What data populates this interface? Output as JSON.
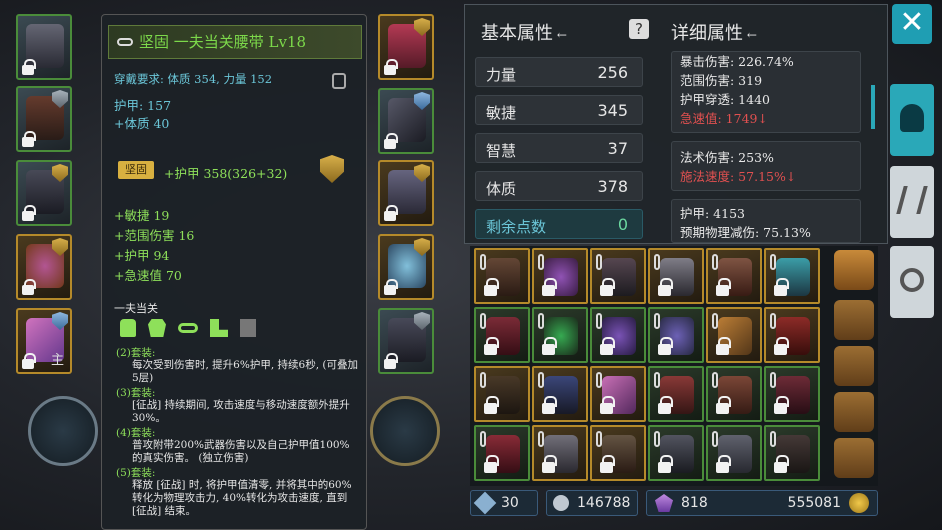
{
  "item": {
    "title": "坚固 一夫当关腰带 Lv18",
    "requirement": "穿戴要求: 体质 354, 力量 152",
    "base_stats": [
      "护甲: 157",
      "+体质 40"
    ],
    "quality_tag": "坚固",
    "quality_bonus": "+护甲 358(326+32)",
    "affixes": [
      "+敏捷 19",
      "+范围伤害 16",
      "+护甲 94",
      "+急速值 70"
    ],
    "set_name": "一夫当关",
    "set_bonuses": [
      {
        "label": "(2)套装:",
        "text": "每次受到伤害时, 提升6%护甲, 持续6秒, (可叠加5层)"
      },
      {
        "label": "(3)套装:",
        "text": "[征战] 持续期间, 攻击速度与移动速度额外提升30%。"
      },
      {
        "label": "(4)套装:",
        "text": "普攻附带200%武器伤害以及自己护甲值100%的真实伤害。 (独立伤害)"
      },
      {
        "label": "(5)套装:",
        "text": "释放 [征战] 时, 将护甲值清零, 并将其中的60%转化为物理攻击力, 40%转化为攻击速度, 直到 [征战] 结束。"
      }
    ]
  },
  "basic_attrs": {
    "header": "基本属性",
    "rows": [
      {
        "label": "力量",
        "value": "256"
      },
      {
        "label": "敏捷",
        "value": "345"
      },
      {
        "label": "智慧",
        "value": "37"
      },
      {
        "label": "体质",
        "value": "378"
      }
    ],
    "remaining_label": "剩余点数",
    "remaining_value": "0"
  },
  "detail_attrs": {
    "header": "详细属性",
    "box1": [
      "暴击伤害: 226.74%",
      "范围伤害: 319",
      "护甲穿透: 1440"
    ],
    "box1_red": "急速值: 1749↓",
    "box2": [
      "法术伤害: 253%"
    ],
    "box2_red": "施法速度: 57.15%↓",
    "box3": [
      "护甲: 4153",
      "预期物理减伤: 75.13%"
    ]
  },
  "currency": {
    "tickets": "30",
    "silver": "146788",
    "gems": "818",
    "gold": "555081"
  },
  "labels": {
    "main_slot": "主",
    "close": "✕"
  },
  "colors": {
    "accent": "#1f9eb3",
    "gold_border": "#b58a2a",
    "green_border": "#4a8c3a",
    "item_name": "#7cd84a",
    "red_stat": "#e05050"
  }
}
